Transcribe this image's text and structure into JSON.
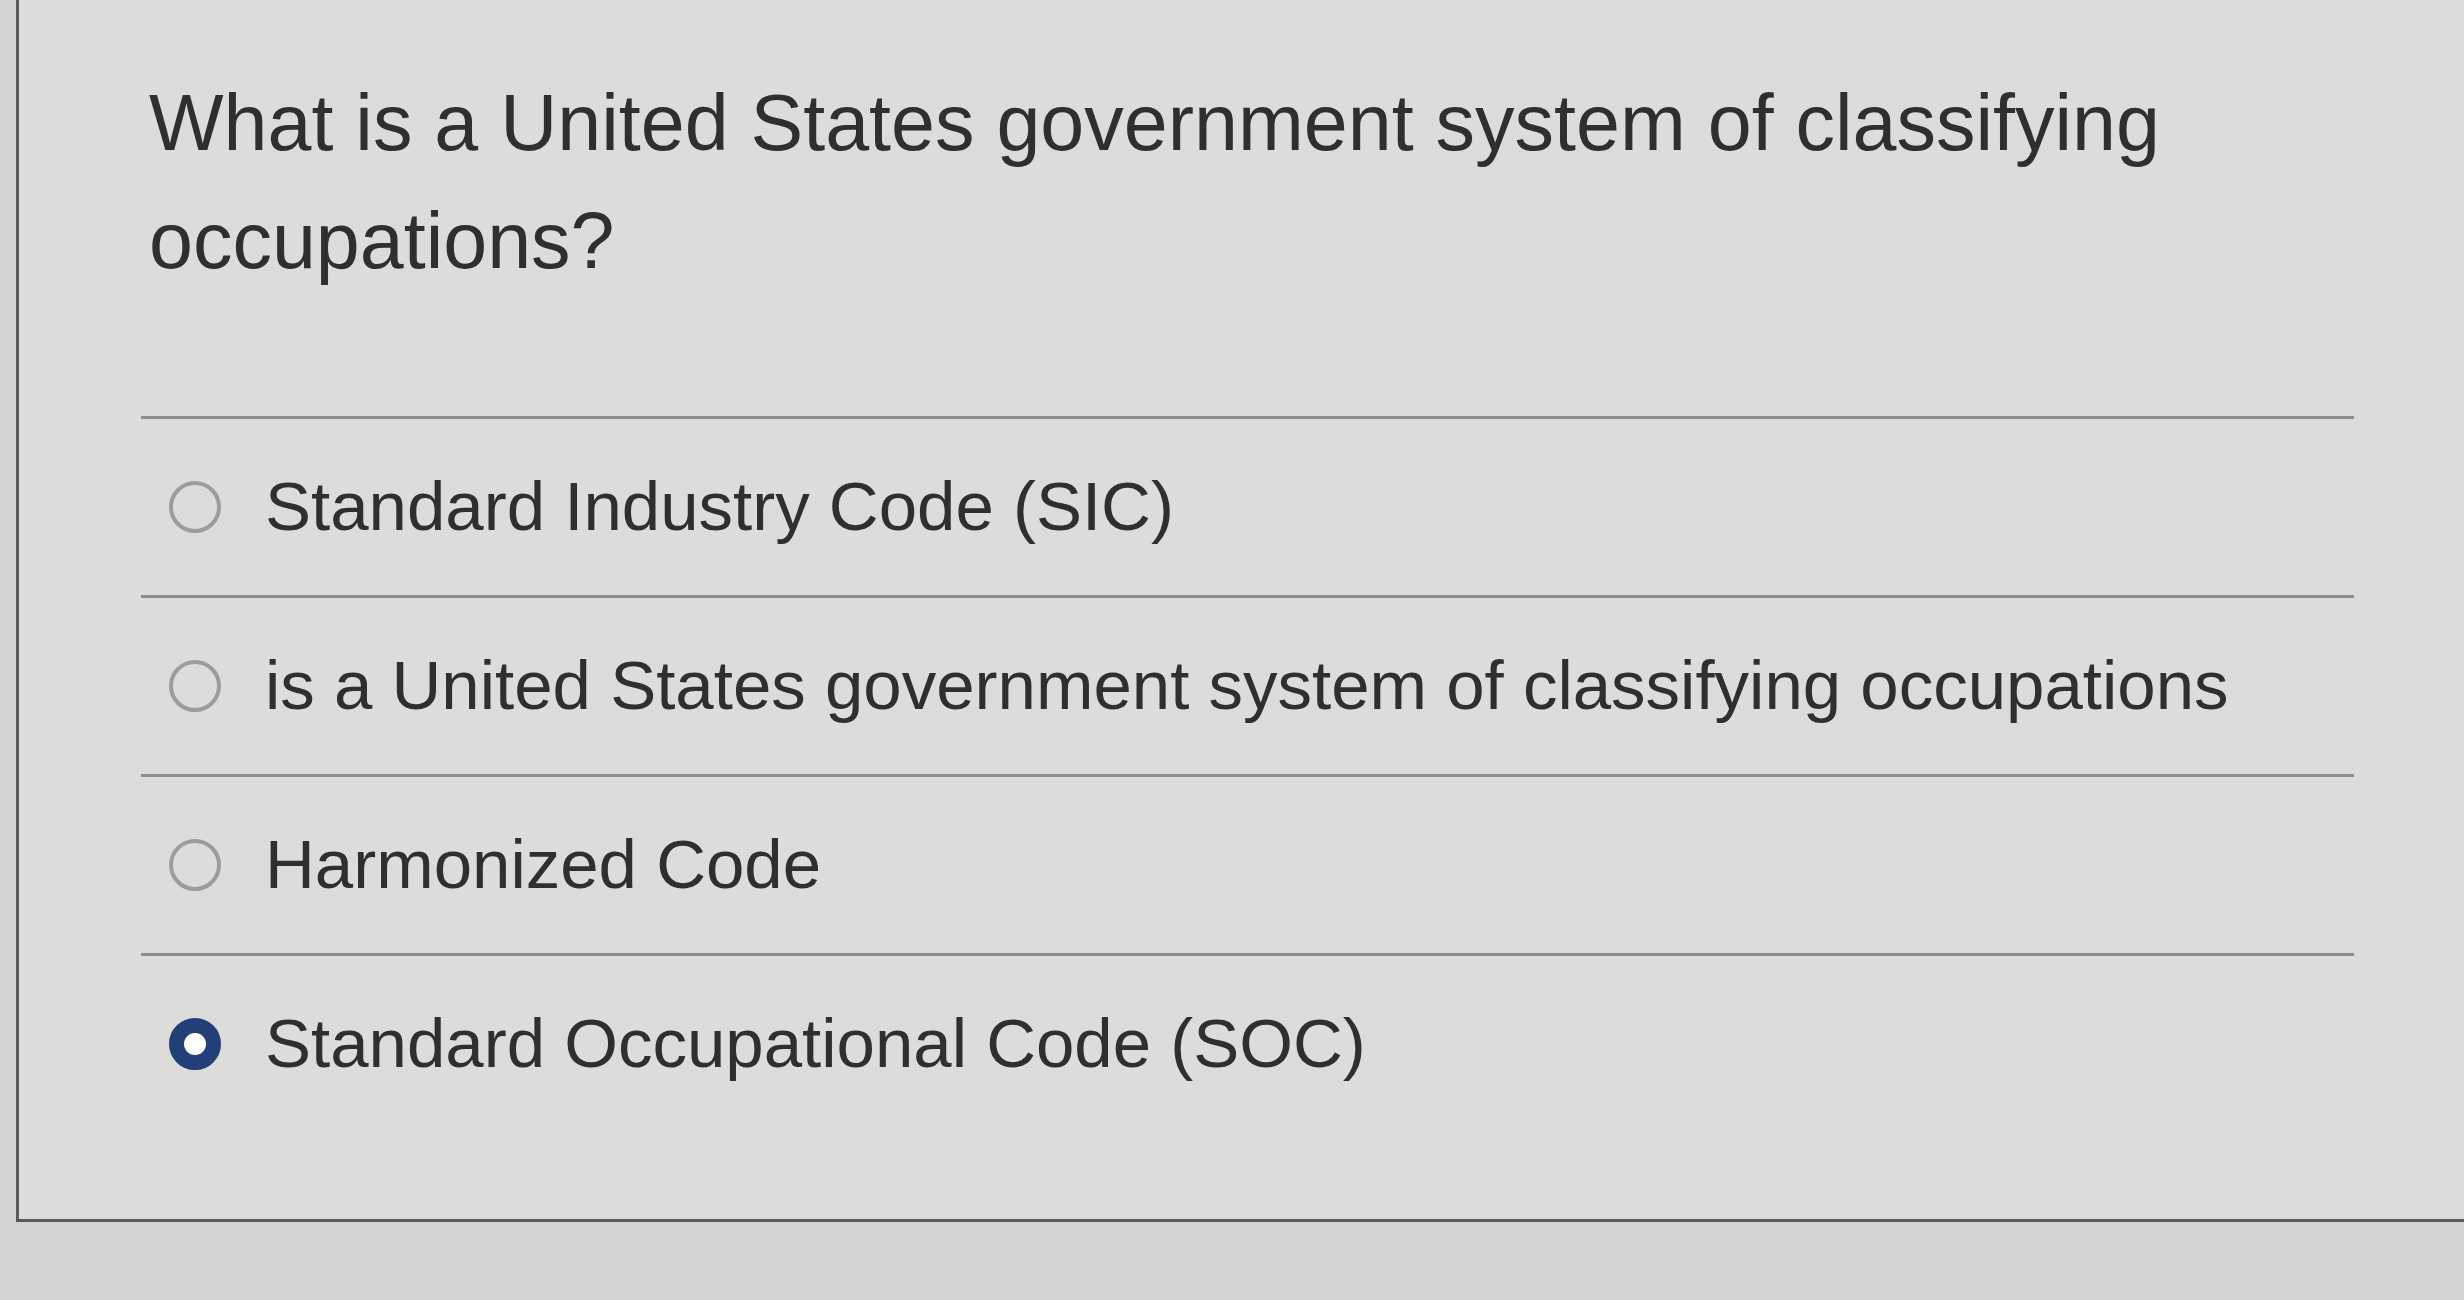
{
  "question": {
    "text": "What is a United States government system of classifying occupations?"
  },
  "options": [
    {
      "label": "Standard Industry Code (SIC)",
      "selected": false
    },
    {
      "label": "is a United States government system of classifying occupations",
      "selected": false
    },
    {
      "label": "Harmonized Code",
      "selected": false
    },
    {
      "label": "Standard Occupational Code (SOC)",
      "selected": true
    }
  ]
}
